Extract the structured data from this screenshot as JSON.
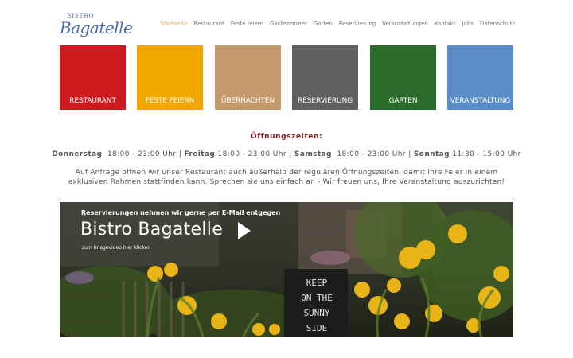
{
  "brand": {
    "small": "BISTRO",
    "name": "Bagatelle"
  },
  "nav": {
    "items": [
      {
        "label": "Startseite",
        "active": true
      },
      {
        "label": "Restaurant"
      },
      {
        "label": "Feste feiern"
      },
      {
        "label": "Gästezimmer"
      },
      {
        "label": "Garten"
      },
      {
        "label": "Reservierung"
      },
      {
        "label": "Veranstaltungen"
      },
      {
        "label": "Kontakt"
      },
      {
        "label": "Jobs"
      },
      {
        "label": "Datenschutz"
      }
    ]
  },
  "tiles": [
    {
      "label": "RESTAURANT",
      "color": "#cc1a1f"
    },
    {
      "label": "FESTE FEIERN",
      "color": "#f0a800"
    },
    {
      "label": "ÜBERNACHTEN",
      "color": "#c49a6c"
    },
    {
      "label": "RESERVIERUNG",
      "color": "#5f5f5f"
    },
    {
      "label": "GARTEN",
      "color": "#2a6b2a"
    },
    {
      "label": "VERANSTALTUNG",
      "color": "#5a8cc8"
    }
  ],
  "hours": {
    "title": "Öffnungszeiten:",
    "days": [
      {
        "day": "Donnerstag",
        "time": "18:00 - 23:00 Uhr"
      },
      {
        "day": "Freitag",
        "time": "18:00 - 23:00 Uhr"
      },
      {
        "day": "Samstag",
        "time": "18:00 - 23:00 Uhr"
      },
      {
        "day": "Sonntag",
        "time": "11:30 - 15:00 Uhr"
      }
    ],
    "separator": "|",
    "description": "Auf Anfrage öffnen wir unser Restaurant auch außerhalb der regulären Öffnungszeiten, damit Ihre Feier in einem exklusiven Rahmen stattfinden kann.  Sprechen sie uns einfach an - Wir freuen uns, Ihre Veranstaltung auszurichten!"
  },
  "banner": {
    "top_text": "Reservierungen nehmen wir gerne per E-Mail entgegen",
    "title": "Bistro Bagatelle",
    "subtitle": "zum Imagevideo hier klicken",
    "icon": "play-icon",
    "sign_lines": [
      "KEEP",
      "ON THE",
      "SUNNY",
      "SIDE"
    ]
  }
}
